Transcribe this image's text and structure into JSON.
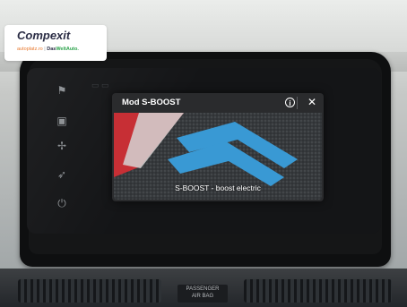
{
  "photo": {
    "watermark": {
      "brand": "Compexit",
      "tagline_part1": "autoplatz.ro",
      "tagline_sep": "|",
      "tagline_part2_a": "Das",
      "tagline_part2_b": "WeltAuto."
    },
    "airbag_label_line1": "PASSENGER",
    "airbag_label_line2": "AIR BAG"
  },
  "screen": {
    "side_rail_icons": [
      "flag-icon",
      "phone-icon",
      "fan-icon",
      "navigation-icon",
      "power-icon"
    ],
    "popup": {
      "title": "Mod S-BOOST",
      "info_glyph": "i",
      "close_glyph": "✕",
      "caption": "S-BOOST - boost electric"
    }
  },
  "colors": {
    "popup_bg": "#2a2b2d",
    "accent_blue": "#3ea6e6",
    "accent_red": "#d8343a"
  }
}
